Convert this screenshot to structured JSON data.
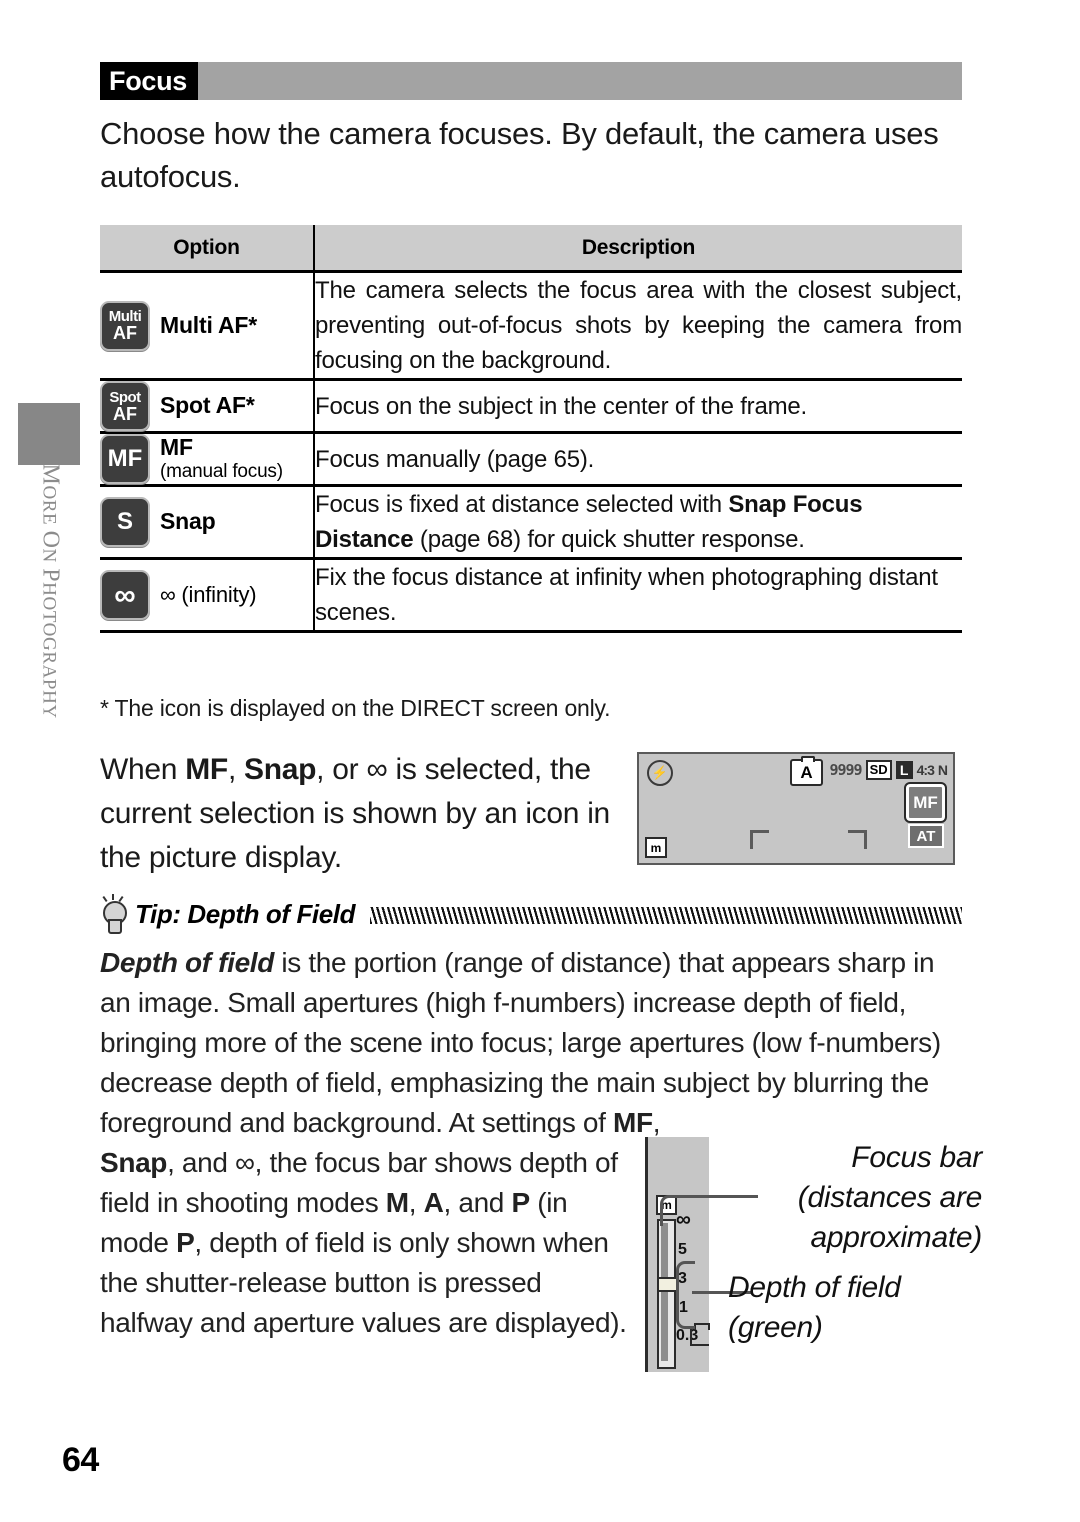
{
  "page": {
    "number": "64",
    "section_tab_label": "MORE ON PHOTOGRAPHY",
    "section_tab_label_small_caps": "M",
    "section_title": "Focus",
    "intro": "Choose how the camera focuses. By default, the camera uses autofocus."
  },
  "table": {
    "headers": {
      "option": "Option",
      "description": "Description"
    },
    "rows": [
      {
        "icon": "multi-af-icon",
        "icon_line1": "Multi",
        "icon_line2": "AF",
        "title": "Multi AF*",
        "subtitle": "",
        "description": "The camera selects the focus area with the closest subject, preventing out-of-focus shots by keeping the camera from focusing on the background."
      },
      {
        "icon": "spot-af-icon",
        "icon_line1": "Spot",
        "icon_line2": "AF",
        "title": "Spot AF*",
        "subtitle": "",
        "description": "Focus on the subject in the center of the frame."
      },
      {
        "icon": "mf-icon",
        "icon_line1": "",
        "icon_line2": "MF",
        "title": "MF",
        "subtitle": "(manual focus)",
        "description": "Focus manually (page 65)."
      },
      {
        "icon": "snap-icon",
        "icon_line1": "",
        "icon_line2": "S",
        "title": "Snap",
        "subtitle": "",
        "description_parts": [
          {
            "text": "Focus is fixed at distance selected with ",
            "bold": false
          },
          {
            "text": "Snap Focus Distance",
            "bold": true
          },
          {
            "text": " (page 68) for quick shutter response.",
            "bold": false
          }
        ]
      },
      {
        "icon": "infinity-icon",
        "icon_line1": "",
        "icon_line2": "∞",
        "title": "∞ (infinity)",
        "subtitle": "",
        "description": "Fix the focus distance at infinity when photographing distant scenes."
      }
    ],
    "footnote": "* The icon is displayed on the DIRECT screen only."
  },
  "when_block": {
    "parts": [
      {
        "text": "When ",
        "style": "normal"
      },
      {
        "text": "MF",
        "style": "bold"
      },
      {
        "text": ", ",
        "style": "normal"
      },
      {
        "text": "Snap",
        "style": "bold"
      },
      {
        "text": ", or ∞ is selected, the current selection is shown by an icon in the picture display.",
        "style": "normal"
      }
    ]
  },
  "lcd_mock": {
    "flash_off_icon": "flash-off-icon",
    "auto_mode_label": "A",
    "frames_remaining": "9999",
    "card_label": "SD",
    "image_size_label": "L",
    "aspect_label": "4:3",
    "quality_label": "N",
    "focus_badge_label": "MF",
    "at_badge_label": "AT",
    "units_label": "m"
  },
  "tip": {
    "icon": "lightbulb-icon",
    "title": "Tip: Depth of Field",
    "paragraph_1_parts": [
      {
        "text": "Depth of field",
        "style": "bold-italic"
      },
      {
        "text": " is the portion (range of distance) that appears sharp in an image. Small apertures (high f-numbers) increase depth of field, bringing more of the scene into focus; large apertures (low f-numbers) decrease depth of field, emphasizing the main subject by blurring the foreground and background. At settings of ",
        "style": "normal"
      },
      {
        "text": "MF",
        "style": "bold"
      },
      {
        "text": ",",
        "style": "normal"
      }
    ],
    "paragraph_2_parts": [
      {
        "text": "Snap",
        "style": "bold"
      },
      {
        "text": ", and ∞, the focus bar shows depth of field in shooting modes ",
        "style": "normal"
      },
      {
        "text": "M",
        "style": "bold"
      },
      {
        "text": ", ",
        "style": "normal"
      },
      {
        "text": "A",
        "style": "bold"
      },
      {
        "text": ", and ",
        "style": "normal"
      },
      {
        "text": "P",
        "style": "bold"
      },
      {
        "text": " (in mode ",
        "style": "normal"
      },
      {
        "text": "P",
        "style": "bold"
      },
      {
        "text": ", depth of field is only shown when the shutter-release button is pressed halfway and aperture values are displayed).",
        "style": "normal"
      }
    ]
  },
  "focus_bar_diagram": {
    "units_label": "m",
    "scale": [
      "∞",
      "5",
      "3",
      "1",
      "0.3"
    ],
    "macro_icon": "macro-icon",
    "callout_focus_bar": "Focus bar (distances are approximate)",
    "callout_depth_of_field": "Depth of field (green)"
  },
  "colors": {
    "section_bar": "#a3a3a3",
    "tag_background": "#000000",
    "table_header_background": "#cccccc",
    "icon_background": "#3d3d3d",
    "lcd_background": "#c6c6c6",
    "side_tab": "#878787"
  }
}
